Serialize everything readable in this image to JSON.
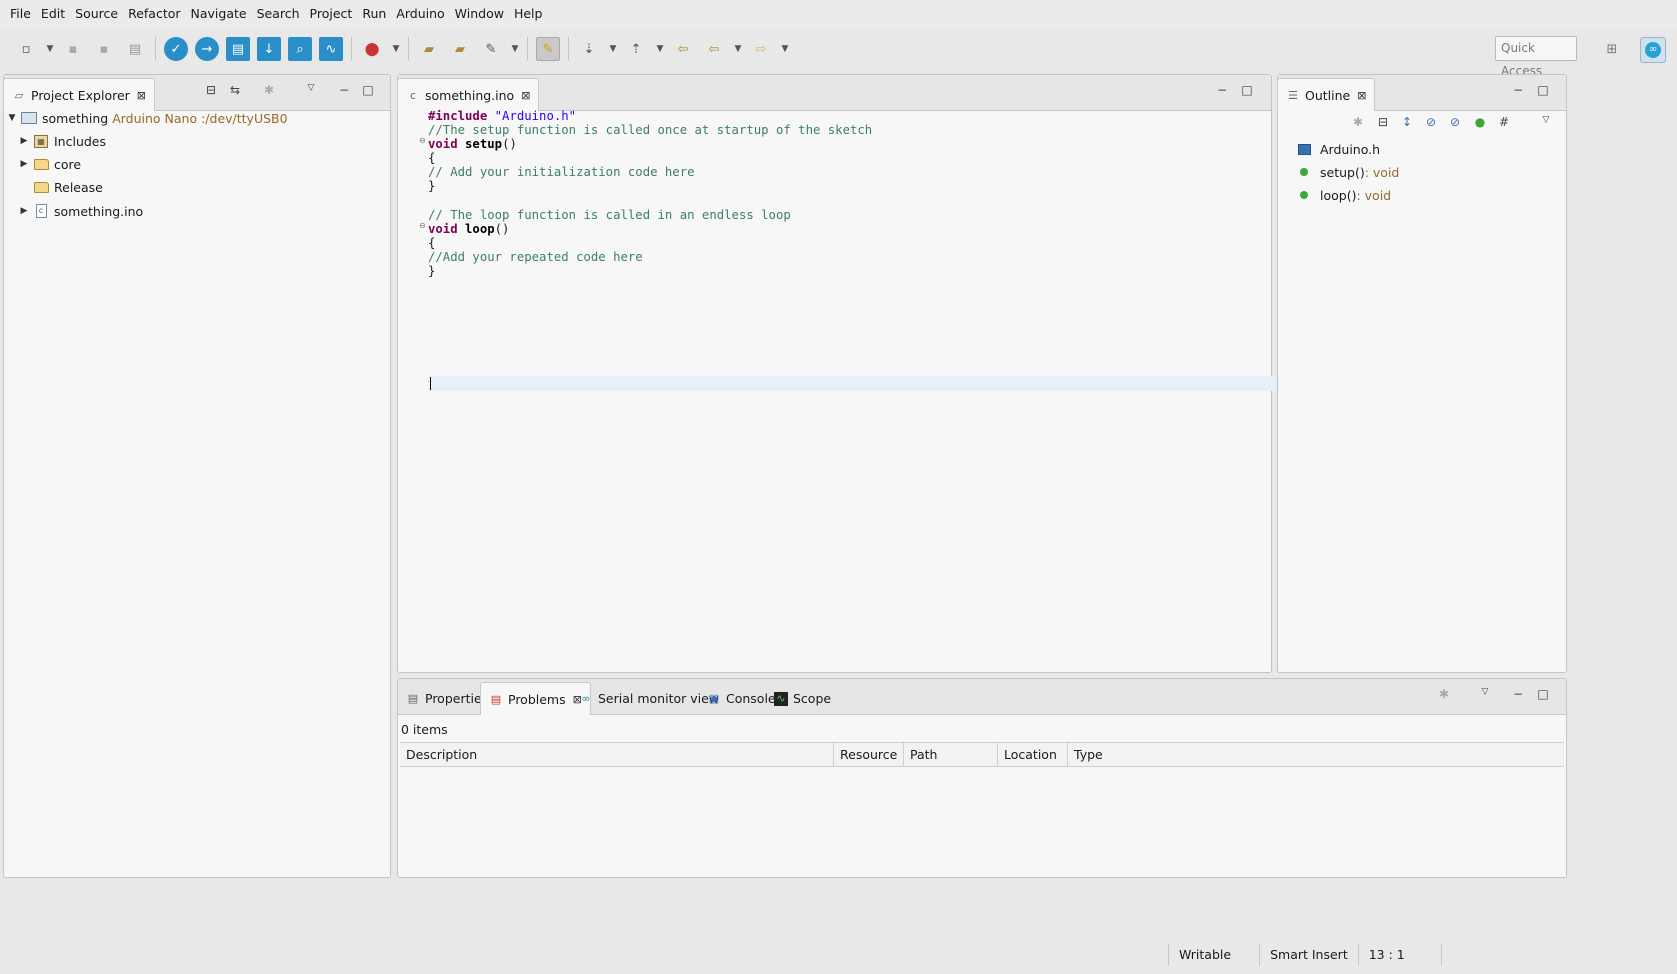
{
  "menu": [
    "File",
    "Edit",
    "Source",
    "Refactor",
    "Navigate",
    "Search",
    "Project",
    "Run",
    "Arduino",
    "Window",
    "Help"
  ],
  "toolbar": {
    "quick_access": "Quick Access"
  },
  "project_explorer": {
    "title": "Project Explorer",
    "project": {
      "name": "something",
      "decoration": "Arduino Nano :/dev/ttyUSB0"
    },
    "items": [
      "Includes",
      "core",
      "Release",
      "something.ino"
    ]
  },
  "editor": {
    "tab": "something.ino",
    "lines": [
      {
        "t": "include",
        "a": "#include ",
        "b": "\"Arduino.h\""
      },
      {
        "t": "comment",
        "a": "//The setup function is called once at startup of the sketch"
      },
      {
        "t": "func",
        "a": "void ",
        "b": "setup",
        "c": "()"
      },
      {
        "t": "plain",
        "a": "{"
      },
      {
        "t": "comment",
        "a": "// Add your initialization code here"
      },
      {
        "t": "plain",
        "a": "}"
      },
      {
        "t": "plain",
        "a": ""
      },
      {
        "t": "comment",
        "a": "// The loop function is called in an endless loop"
      },
      {
        "t": "func",
        "a": "void ",
        "b": "loop",
        "c": "()"
      },
      {
        "t": "plain",
        "a": "{"
      },
      {
        "t": "comment",
        "a": "//Add your repeated code here"
      },
      {
        "t": "plain",
        "a": "}"
      },
      {
        "t": "plain",
        "a": ""
      }
    ]
  },
  "outline": {
    "title": "Outline",
    "items": [
      {
        "name": "Arduino.h",
        "type": ""
      },
      {
        "name": "setup()",
        "type": " : void"
      },
      {
        "name": "loop()",
        "type": " : void"
      }
    ]
  },
  "bottom": {
    "tabs": [
      "Properties",
      "Problems",
      "Serial monitor view",
      "Console",
      "Scope"
    ],
    "count": "0 items",
    "columns": [
      "Description",
      "Resource",
      "Path",
      "Location",
      "Type"
    ]
  },
  "status": {
    "writable": "Writable",
    "insert_mode": "Smart Insert",
    "position": "13 : 1"
  }
}
